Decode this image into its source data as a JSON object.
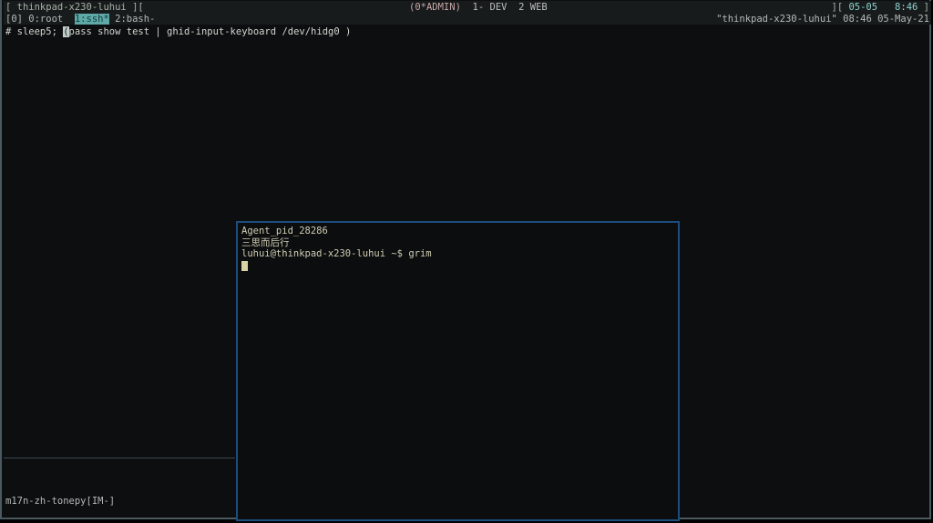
{
  "colors": {
    "frame_border": "#4b5960",
    "floating_window_border": "#1d4d7e",
    "statusbar_bg": "#181b1b",
    "hostname_text": "#a6b2a8",
    "admin_window_text": "#c9a6a6",
    "window_list_text": "#bcbfc1",
    "clock_text": "#8ed2d0",
    "tmux_text": "#b4bab8",
    "active_tab_bg": "#5fa8a8",
    "active_tab_text": "#123c3e",
    "command_text": "#d2d6d0",
    "command_cursor_bg": "#c3cdc9",
    "floating_text": "#d0cdb4",
    "floating_cursor_bg": "#d8d2a4"
  },
  "screen_status": {
    "left": "[ thinkpad-x230-luhui ][",
    "admin_window": "(0*ADMIN)",
    "other_windows": "  1- DEV  2 WEB",
    "right_open": "][ ",
    "date": "05-05",
    "gap": "   ",
    "time": "8:46",
    "right_close": " ]"
  },
  "tmux_status": {
    "left": "[0] 0:root  ",
    "active_window": "1:ssh*",
    "other_window": " 2:bash-",
    "right": "\"thinkpad-x230-luhui\" 08:46 05-May-21"
  },
  "command_line": {
    "before_cursor": "# sleep5; ",
    "at_cursor": "(",
    "after_cursor": "pass show test | ghid-input-keyboard /dev/hidg0 )"
  },
  "im_status": "m17n-zh-tonepy[IM-]",
  "floating_terminal": {
    "lines": {
      "0": "Agent_pid_28286",
      "1": "三思而后行",
      "2": "luhui@thinkpad-x230-luhui ~$ grim"
    }
  }
}
